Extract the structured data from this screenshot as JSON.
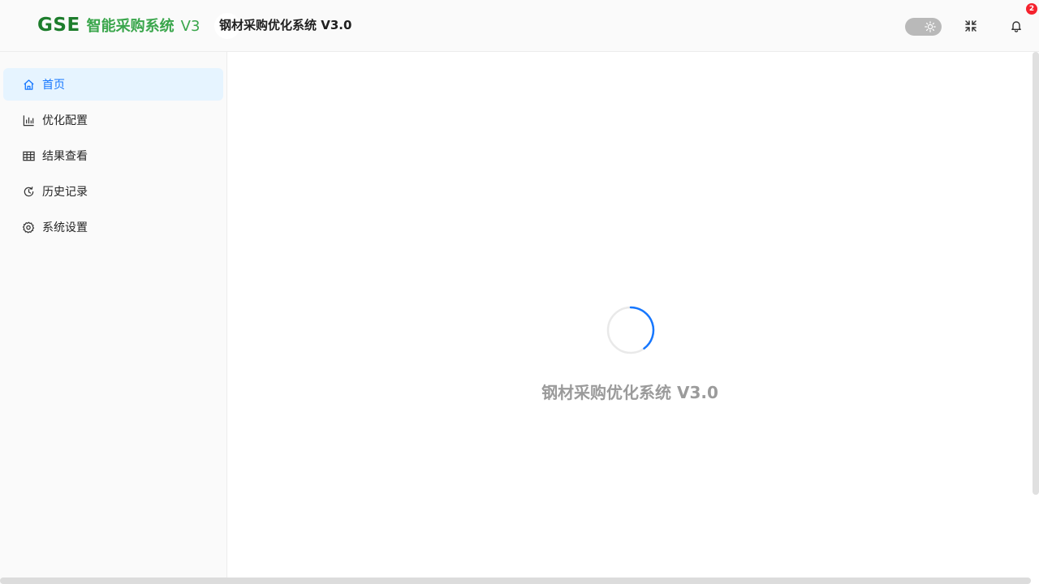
{
  "header": {
    "logo": {
      "brand": "GSE",
      "name": "智能采购系统",
      "version": "V3"
    },
    "title": "钢材采购优化系统 V3.0",
    "theme_toggle_icon": "sun-icon",
    "fullscreen_icon": "fullscreen-icon",
    "notification_icon": "bell-icon",
    "notification_count": "2"
  },
  "sidebar": {
    "items": [
      {
        "label": "首页",
        "icon": "home-icon",
        "active": true
      },
      {
        "label": "优化配置",
        "icon": "bar-chart-icon",
        "active": false
      },
      {
        "label": "结果查看",
        "icon": "table-icon",
        "active": false
      },
      {
        "label": "历史记录",
        "icon": "history-icon",
        "active": false
      },
      {
        "label": "系统设置",
        "icon": "gear-icon",
        "active": false
      }
    ]
  },
  "main": {
    "loading_text": "钢材采购优化系统 V3.0"
  },
  "colors": {
    "brand_green": "#1d7d2c",
    "accent_green": "#3aa64c",
    "primary_blue": "#1677ff",
    "active_bg": "#e6f4ff"
  }
}
